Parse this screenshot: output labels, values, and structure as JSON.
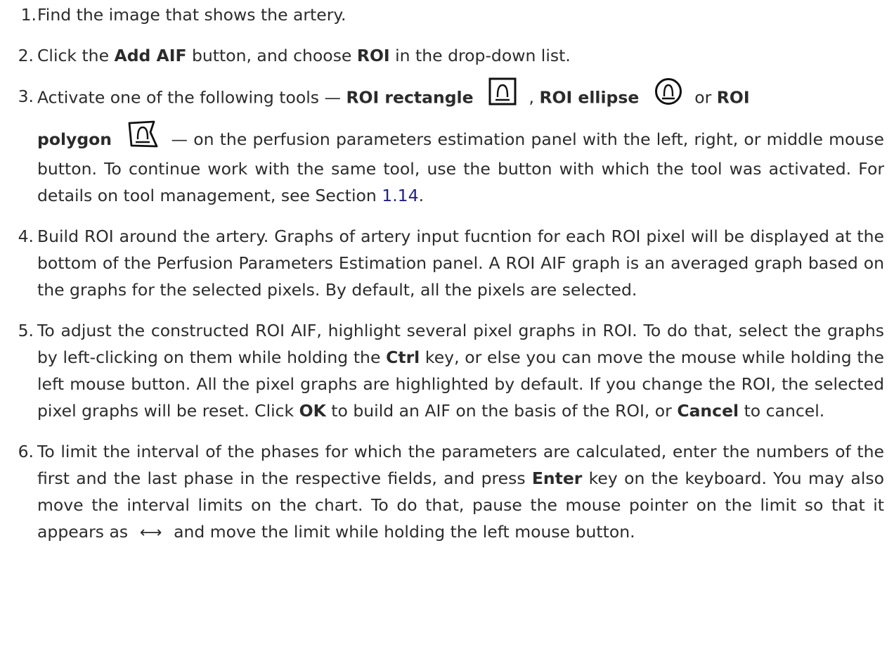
{
  "steps": [
    {
      "number": "1.",
      "text": "Find the image that shows the artery."
    },
    {
      "number": "2.",
      "t1": "Click the ",
      "b1": "Add AIF",
      "t2": " button, and choose ",
      "b2": "ROI",
      "t3": " in the drop-down list."
    },
    {
      "number": "3.",
      "t1": "Activate one of the following tools — ",
      "b1": "ROI rectangle",
      "t2": " , ",
      "b2": "ROI ellipse",
      "t3": " or ",
      "b3": "ROI",
      "b4": "polygon",
      "t4": " — on the perfusion parameters estimation panel with the left, right, or middle mouse button. To continue work with the same tool, use the button with which the tool was activated. For details on tool management, see Section ",
      "link": "1.14",
      "t5": ".",
      "icons": [
        "roi-rectangle-icon",
        "roi-ellipse-icon",
        "roi-polygon-icon"
      ]
    },
    {
      "number": "4.",
      "text": "Build ROI around the artery. Graphs of artery input fucntion for each ROI pixel will be displayed at the bottom of the Perfusion Parameters Estimation panel. A ROI AIF graph is an averaged graph based on the graphs for the selected pixels. By default, all the pixels are selected."
    },
    {
      "number": "5.",
      "t1": "To adjust the constructed ROI AIF, highlight several pixel graphs in ROI. To do that, select the graphs by left-clicking on them while holding the ",
      "b1": "Ctrl",
      "t2": " key, or else you can move the mouse while holding the left mouse button. All the pixel graphs are highlighted by default. If you change the ROI, the selected pixel graphs will be reset. Click ",
      "b2": "OK",
      "t3": " to build an AIF on the basis of the ROI, or ",
      "b3": "Cancel",
      "t4": " to cancel."
    },
    {
      "number": "6.",
      "t1": "To limit the interval of the phases for which the parameters are calculated, enter the numbers of the first and the last phase in the respective fields, and press ",
      "b1": "Enter",
      "t2": " key on the keyboard. You may also move the interval limits on the chart. To do that, pause the mouse pointer on the limit so that it appears as ",
      "glyph": "⟷",
      "t3": " and move the limit while holding the left mouse button."
    }
  ]
}
